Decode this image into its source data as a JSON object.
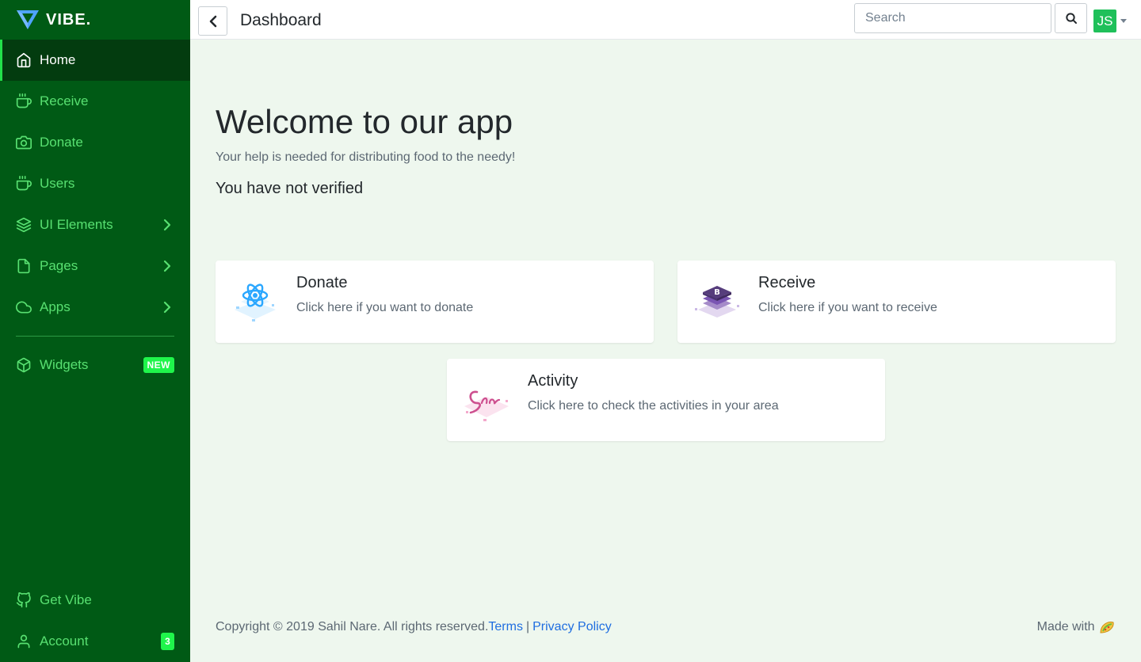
{
  "brand": {
    "name": "VIBE."
  },
  "sidebar": {
    "items": [
      {
        "label": "Home",
        "icon": "home-icon",
        "active": true
      },
      {
        "label": "Receive",
        "icon": "coffee-icon"
      },
      {
        "label": "Donate",
        "icon": "camera-icon"
      },
      {
        "label": "Users",
        "icon": "coffee-icon"
      },
      {
        "label": "UI Elements",
        "icon": "layers-icon",
        "has_children": true
      },
      {
        "label": "Pages",
        "icon": "file-icon",
        "has_children": true
      },
      {
        "label": "Apps",
        "icon": "cloud-icon",
        "has_children": true
      }
    ],
    "widgets": {
      "label": "Widgets",
      "badge": "NEW",
      "icon": "box-icon"
    },
    "bottom": {
      "get_vibe": {
        "label": "Get Vibe",
        "icon": "github-icon"
      },
      "account": {
        "label": "Account",
        "badge": "3",
        "icon": "user-icon"
      }
    }
  },
  "topbar": {
    "title": "Dashboard",
    "search_placeholder": "Search",
    "avatar_initials": "JS"
  },
  "main": {
    "heading": "Welcome to our app",
    "lead": "Your help is needed for distributing food to the needy!",
    "status": "You have not verified",
    "cards": [
      {
        "title": "Donate",
        "description": "Click here if you want to donate",
        "logo": "react-logo"
      },
      {
        "title": "Receive",
        "description": "Click here if you want to receive",
        "logo": "bootstrap-logo"
      },
      {
        "title": "Activity",
        "description": "Click here to check the activities in your area",
        "logo": "sass-logo"
      }
    ]
  },
  "footer": {
    "copyright": "Copyright © 2019 Sahil Nare. All rights reserved.",
    "terms": "Terms",
    "separator": "|",
    "privacy": "Privacy Policy",
    "made_with": "Made with"
  },
  "colors": {
    "sidebar_bg": "#005a15",
    "sidebar_active_bg": "#033c0f",
    "sidebar_link": "#58e071",
    "badge": "#1ff54b",
    "avatar": "#1fc05a",
    "link": "#1f6ee0",
    "page_bg": "#eef7ee"
  }
}
